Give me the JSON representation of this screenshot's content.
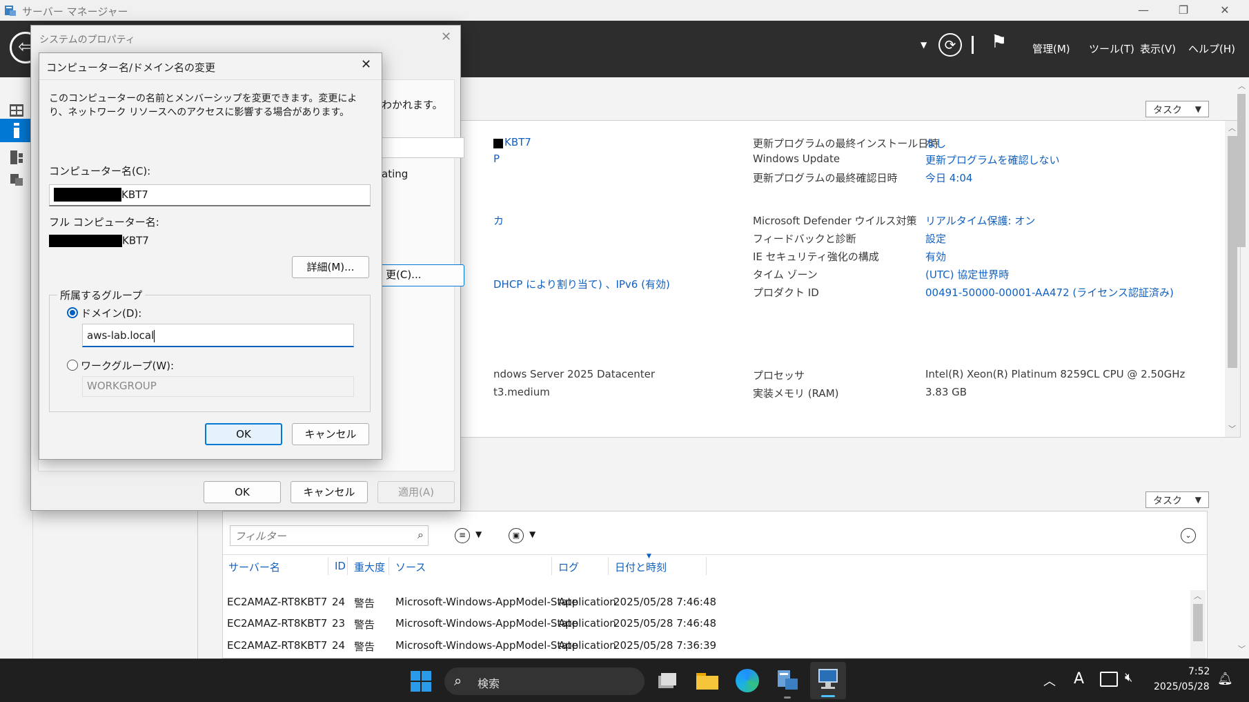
{
  "window": {
    "title": "サーバー マネージャー"
  },
  "header": {
    "menu": [
      "管理(M)",
      "ツール(T)",
      "表示(V)",
      "ヘルプ(H)"
    ]
  },
  "properties": {
    "task_label": "タスク",
    "left_col": [
      {
        "text": "KBT7"
      },
      {
        "text": "P"
      },
      {
        "text": "カ"
      },
      {
        "text": "DHCP により割り当て) 、IPv6 (有効)"
      },
      {
        "text": "ndows Server 2025 Datacenter"
      },
      {
        "text": "t3.medium"
      }
    ],
    "right_rows": [
      {
        "label": "更新プログラムの最終インストール日時",
        "value": "なし"
      },
      {
        "label": "Windows Update",
        "value": "更新プログラムを確認しない"
      },
      {
        "label": "更新プログラムの最終確認日時",
        "value": "今日 4:04"
      },
      {
        "label": "Microsoft Defender ウイルス対策",
        "value": "リアルタイム保護: オン"
      },
      {
        "label": "フィードバックと診断",
        "value": "設定"
      },
      {
        "label": "IE セキュリティ強化の構成",
        "value": "有効"
      },
      {
        "label": "タイム ゾーン",
        "value": "(UTC) 協定世界時"
      },
      {
        "label": "プロダクト ID",
        "value": "00491-50000-00001-AA472 (ライセンス認証済み)"
      },
      {
        "label": "プロセッサ",
        "value": "Intel(R) Xeon(R) Platinum 8259CL CPU @ 2.50GHz"
      },
      {
        "label": "実装メモリ (RAM)",
        "value": "3.83 GB"
      }
    ]
  },
  "events": {
    "task_label": "タスク",
    "filter_placeholder": "フィルター",
    "columns": [
      "サーバー名",
      "ID",
      "重大度",
      "ソース",
      "ログ",
      "日付と時刻"
    ],
    "rows": [
      [
        "EC2AMAZ-RT8KBT7",
        "24",
        "警告",
        "Microsoft-Windows-AppModel-State",
        "Application",
        "2025/05/28 7:46:48"
      ],
      [
        "EC2AMAZ-RT8KBT7",
        "23",
        "警告",
        "Microsoft-Windows-AppModel-State",
        "Application",
        "2025/05/28 7:46:48"
      ],
      [
        "EC2AMAZ-RT8KBT7",
        "24",
        "警告",
        "Microsoft-Windows-AppModel-State",
        "Application",
        "2025/05/28 7:36:39"
      ]
    ]
  },
  "system_properties": {
    "title": "システムのプロパティ",
    "suffix_text": "わかれます。",
    "ating_text": "ating",
    "change_button": "更(C)...",
    "ok": "OK",
    "cancel": "キャンセル",
    "apply": "適用(A)"
  },
  "rename_dialog": {
    "title": "コンピューター名/ドメイン名の変更",
    "description": "このコンピューターの名前とメンバーシップを変更できます。変更により、ネットワーク リソースへのアクセスに影響する場合があります。",
    "computer_name_label": "コンピューター名(C):",
    "computer_name_value": "KBT7",
    "full_name_label": "フル コンピューター名:",
    "full_name_value": "KBT7",
    "details_button": "詳細(M)...",
    "group_label": "所属するグループ",
    "domain_label": "ドメイン(D):",
    "domain_value": "aws-lab.local",
    "workgroup_label": "ワークグループ(W):",
    "workgroup_value": "WORKGROUP",
    "ok": "OK",
    "cancel": "キャンセル"
  },
  "taskbar": {
    "search_label": "検索",
    "time": "7:52",
    "date": "2025/05/28",
    "ime": "A"
  },
  "colors": {
    "accent": "#0078d4",
    "link": "#1060c0",
    "header": "#2d2d2d"
  }
}
